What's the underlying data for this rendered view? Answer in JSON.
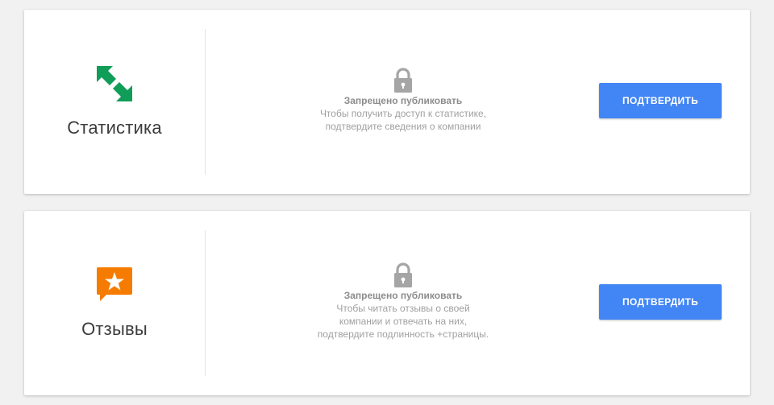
{
  "cards": [
    {
      "title": "Статистика",
      "icon": "swap-arrows-icon",
      "restricted_title": "Запрещено публиковать",
      "restricted_lines": [
        "Чтобы получить доступ к статистике,",
        "подтвердите сведения о компании"
      ],
      "button_label": "ПОДТВЕРДИТЬ"
    },
    {
      "title": "Отзывы",
      "icon": "review-star-icon",
      "restricted_title": "Запрещено публиковать",
      "restricted_lines": [
        "Чтобы читать отзывы о своей",
        "компании и отвечать на них,",
        "подтвердите подлинность +страницы."
      ],
      "button_label": "ПОДТВЕРДИТЬ"
    }
  ],
  "colors": {
    "accent": "#4285f4",
    "stats_icon": "#0f9d58",
    "reviews_icon": "#f57c00",
    "lock": "#a5a5a5"
  }
}
